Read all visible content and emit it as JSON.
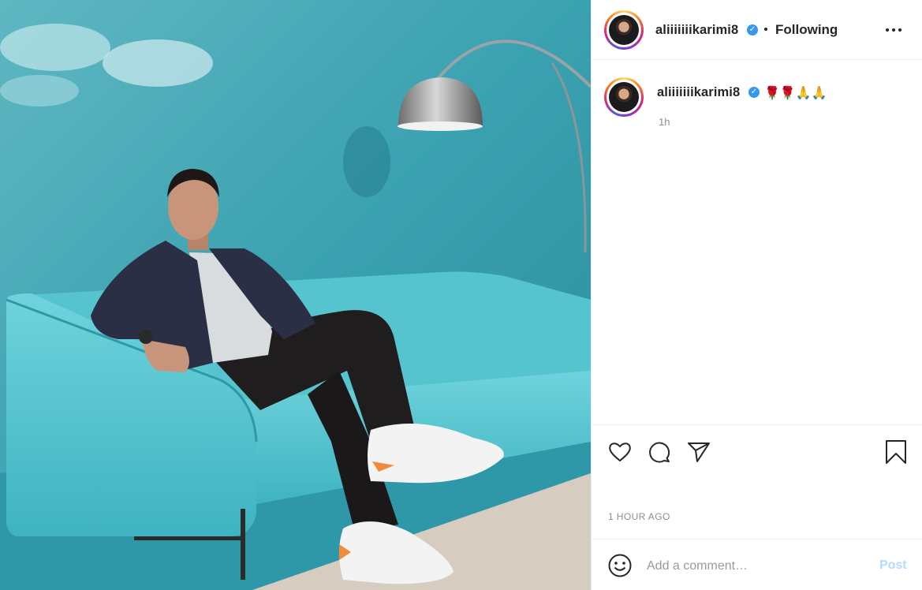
{
  "post": {
    "author": "aliiiiiiikarimi8",
    "verified_mark": "✓",
    "follow_status": "Following",
    "caption": "🌹🌹🙏🙏",
    "relative_time": "1h",
    "timestamp": "1 HOUR AGO",
    "image": {
      "icon": "photo-of-man-on-turquoise-sofa",
      "colors": {
        "wall": "#3a9fae",
        "sofa": "#4fc3d0",
        "floor": "#d6ccbf"
      }
    }
  },
  "actions": {
    "like_icon": "heart-icon",
    "comment_icon": "comment-bubble-icon",
    "share_icon": "paper-plane-icon",
    "save_icon": "bookmark-icon",
    "more_icon": "more-options-icon"
  },
  "comment_box": {
    "emoji_icon": "smiley-icon",
    "placeholder": "Add a comment…",
    "post_label": "Post"
  },
  "colors": {
    "verified": "#3897f0",
    "post_disabled": "#b3dbff",
    "muted": "#8e8e8e"
  }
}
